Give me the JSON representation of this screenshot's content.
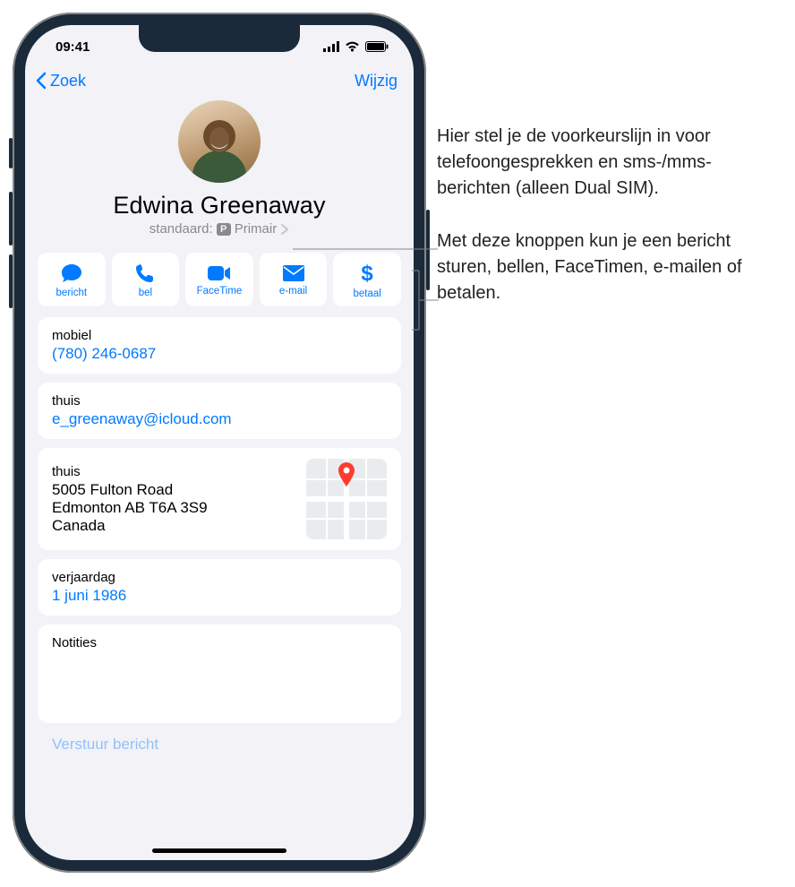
{
  "status": {
    "time": "09:41"
  },
  "nav": {
    "back": "Zoek",
    "edit": "Wijzig"
  },
  "contact": {
    "name": "Edwina Greenaway",
    "default_prefix": "standaard:",
    "sim_badge": "P",
    "default_line": "Primair"
  },
  "actions": {
    "message": "bericht",
    "call": "bel",
    "facetime": "FaceTime",
    "email": "e-mail",
    "pay": "betaal"
  },
  "fields": {
    "mobile_label": "mobiel",
    "mobile_value": "(780) 246-0687",
    "home_email_label": "thuis",
    "home_email_value": "e_greenaway@icloud.com",
    "home_addr_label": "thuis",
    "addr_line1": "5005 Fulton Road",
    "addr_line2": "Edmonton AB T6A 3S9",
    "addr_line3": "Canada",
    "birthday_label": "verjaardag",
    "birthday_value": "1 juni 1986",
    "notes_label": "Notities"
  },
  "bottom_link": "Verstuur bericht",
  "callouts": {
    "c1": "Hier stel je de voorkeurslijn in voor telefoongesprekken en sms-/mms-berichten (alleen Dual SIM).",
    "c2": "Met deze knoppen kun je een bericht sturen, bellen, FaceTimen, e-mailen of betalen."
  }
}
